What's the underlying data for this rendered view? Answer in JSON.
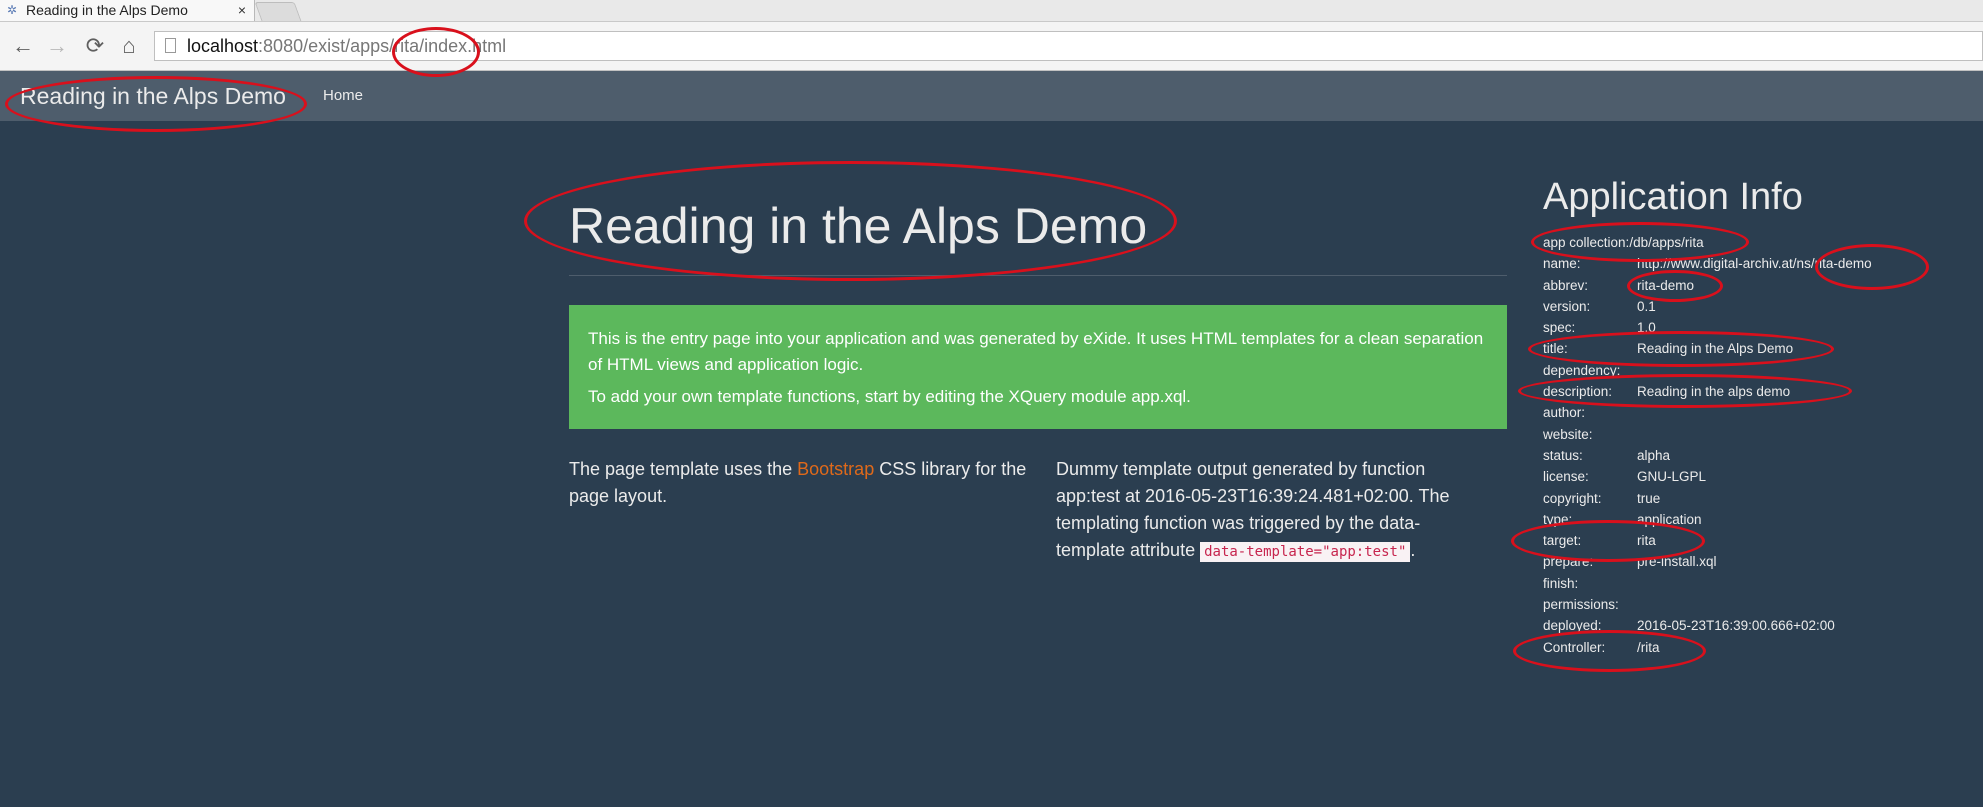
{
  "browser": {
    "tab_title": "Reading in the Alps Demo",
    "tab_close": "×",
    "url_host": "localhost",
    "url_rest": ":8080/exist/apps/rita/index.html",
    "nav": {
      "back": "←",
      "forward": "→",
      "reload": "⟳",
      "home": "⌂"
    }
  },
  "navbar": {
    "brand": "Reading in the Alps Demo",
    "links": [
      "Home"
    ]
  },
  "main": {
    "title": "Reading in the Alps Demo",
    "alert": {
      "line1": "This is the entry page into your application and was generated by eXide. It uses HTML templates for a clean separation of HTML views and application logic.",
      "line2": "To add your own template functions, start by editing the XQuery module app.xql."
    },
    "left_col": {
      "prefix": "The page template uses the ",
      "link": "Bootstrap",
      "suffix": " CSS library for the page layout."
    },
    "right_col": {
      "text": "Dummy template output generated by function app:test at 2016-05-23T16:39:24.481+02:00. The templating function was triggered by the data-template attribute ",
      "code": "data-template=\"app:test\"",
      "end": "."
    }
  },
  "info": {
    "title": "Application Info",
    "collection_label": "app collection:",
    "collection_value": "/db/apps/rita",
    "rows": [
      {
        "key": "name:",
        "value": "http://www.digital-archiv.at/ns/rita-demo"
      },
      {
        "key": "abbrev:",
        "value": "rita-demo"
      },
      {
        "key": "version:",
        "value": "0.1"
      },
      {
        "key": "spec:",
        "value": "1.0"
      },
      {
        "key": "title:",
        "value": "Reading in the Alps Demo"
      },
      {
        "key": "dependency:",
        "value": ""
      },
      {
        "key": "description:",
        "value": "Reading in the alps demo"
      },
      {
        "key": "author:",
        "value": ""
      },
      {
        "key": "website:",
        "value": ""
      },
      {
        "key": "status:",
        "value": "alpha"
      },
      {
        "key": "license:",
        "value": "GNU-LGPL"
      },
      {
        "key": "copyright:",
        "value": "true"
      },
      {
        "key": "type:",
        "value": "application"
      },
      {
        "key": "target:",
        "value": "rita"
      },
      {
        "key": "prepare:",
        "value": "pre-install.xql"
      },
      {
        "key": "finish:",
        "value": ""
      },
      {
        "key": "permissions:",
        "value": ""
      },
      {
        "key": "deployed:",
        "value": "2016-05-23T16:39:00.666+02:00"
      },
      {
        "key": "Controller:",
        "value": "/rita"
      }
    ]
  },
  "colors": {
    "background": "#2b3e50",
    "navbar": "#4e5d6c",
    "alert": "#5cb85c",
    "link": "#df691a",
    "annotation": "#d9101c"
  }
}
